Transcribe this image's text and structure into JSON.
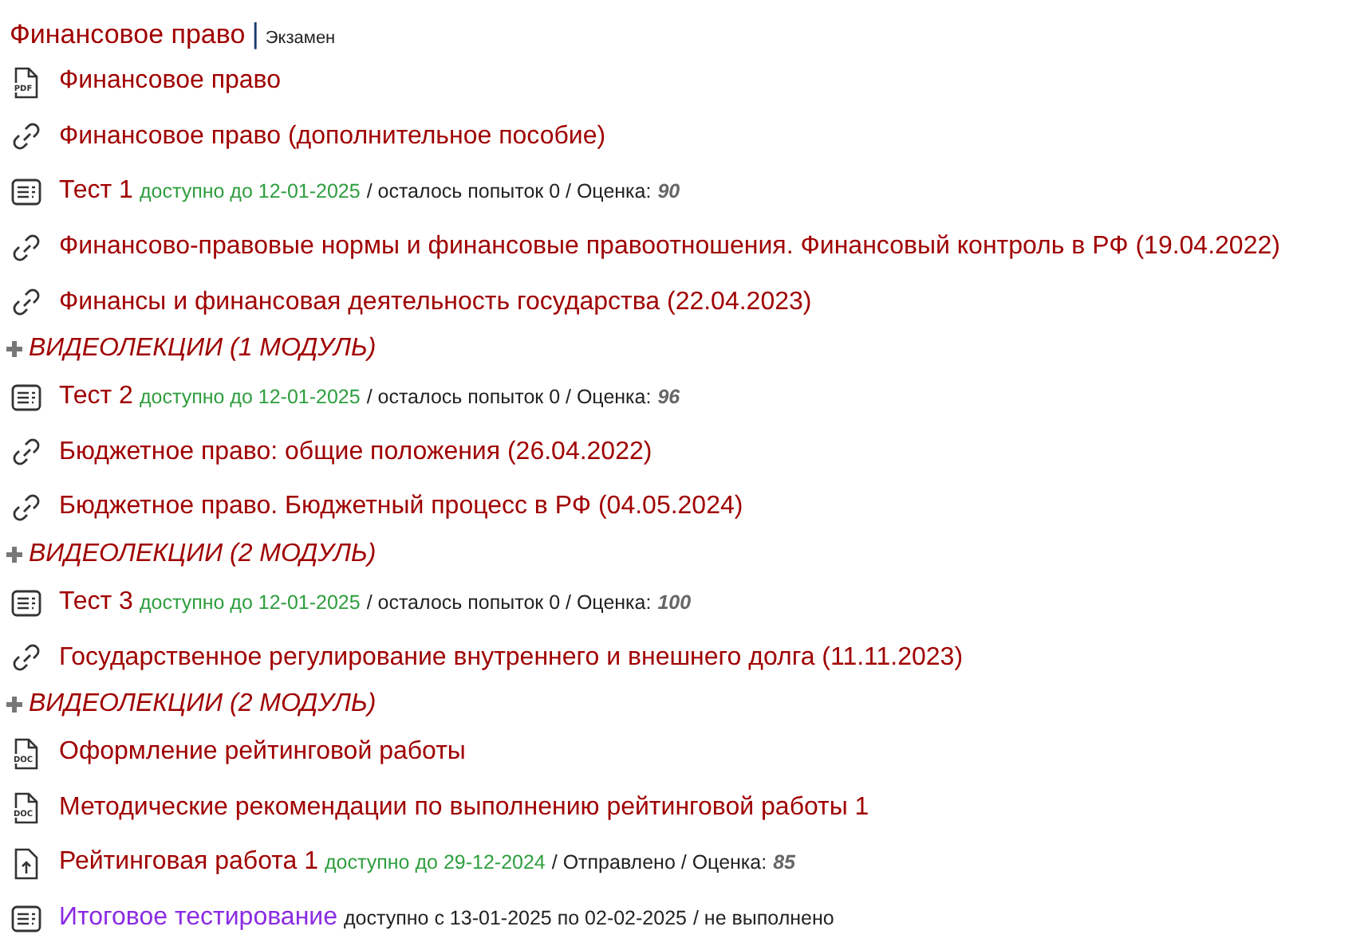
{
  "course": {
    "title": "Финансовое право",
    "separator": "|",
    "exam_type": "Экзамен"
  },
  "items": [
    {
      "kind": "pdf",
      "title": "Финансовое право",
      "visited": true,
      "icon_label": "PDF"
    },
    {
      "kind": "link",
      "title": "Финансовое право (дополнительное пособие)",
      "visited": true
    },
    {
      "kind": "test",
      "title": "Тест 1",
      "visited": true,
      "availability": "доступно до 12-01-2025",
      "available_now": true,
      "status": "/ осталось попыток 0 / Оценка:",
      "grade": "90"
    },
    {
      "kind": "link",
      "title": "Финансово-правовые нормы и финансовые правоотношения. Финансовый контроль в РФ (19.04.2022)",
      "visited": true
    },
    {
      "kind": "link",
      "title": "Финансы и финансовая деятельность государства (22.04.2023)",
      "visited": true
    },
    {
      "kind": "section",
      "title": "ВИДЕОЛЕКЦИИ (1 МОДУЛЬ)",
      "expanded": false
    },
    {
      "kind": "test",
      "title": "Тест 2",
      "visited": true,
      "availability": "доступно до 12-01-2025",
      "available_now": true,
      "status": "/ осталось попыток 0 / Оценка:",
      "grade": "96"
    },
    {
      "kind": "link",
      "title": "Бюджетное право: общие положения (26.04.2022)",
      "visited": true
    },
    {
      "kind": "link",
      "title": "Бюджетное право. Бюджетный процесс в РФ (04.05.2024)",
      "visited": true
    },
    {
      "kind": "section",
      "title": "ВИДЕОЛЕКЦИИ (2 МОДУЛЬ)",
      "expanded": false
    },
    {
      "kind": "test",
      "title": "Тест 3",
      "visited": true,
      "availability": "доступно до 12-01-2025",
      "available_now": true,
      "status": "/ осталось попыток 0 / Оценка:",
      "grade": "100"
    },
    {
      "kind": "link",
      "title": "Государственное регулирование внутреннего и внешнего долга (11.11.2023)",
      "visited": true
    },
    {
      "kind": "section",
      "title": "ВИДЕОЛЕКЦИИ (2 МОДУЛЬ)",
      "expanded": false
    },
    {
      "kind": "doc",
      "title": "Оформление рейтинговой работы",
      "visited": true,
      "icon_label": "DOC"
    },
    {
      "kind": "doc",
      "title": "Методические рекомендации по выполнению рейтинговой работы 1",
      "visited": true,
      "icon_label": "DOC"
    },
    {
      "kind": "upload",
      "title": "Рейтинговая работа 1",
      "visited": true,
      "availability": "доступно до 29-12-2024",
      "available_now": true,
      "status": "/ Отправлено / Оценка:",
      "grade": "85"
    },
    {
      "kind": "test",
      "title": "Итоговое тестирование",
      "visited": false,
      "availability": "доступно с 13-01-2025 по 02-02-2025",
      "available_now": false,
      "status": "/ не выполнено"
    }
  ]
}
